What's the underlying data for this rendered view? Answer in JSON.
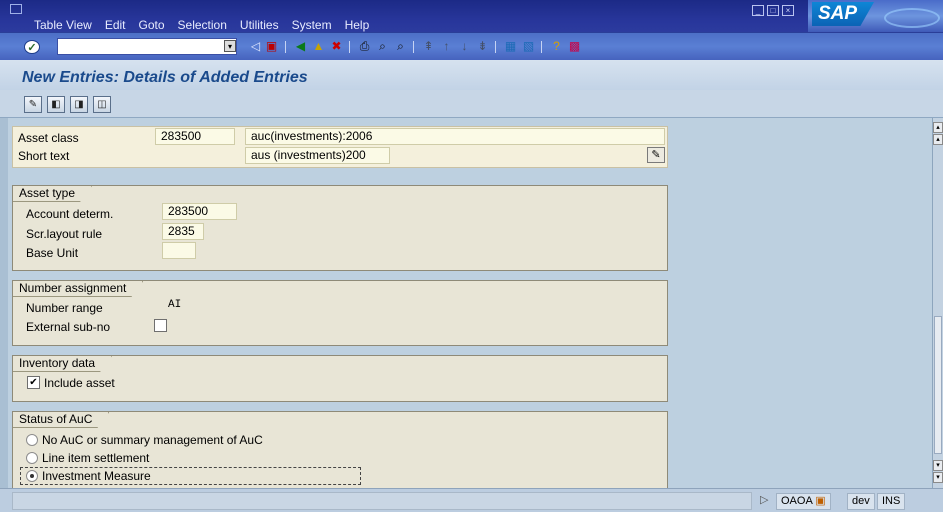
{
  "menu": {
    "items": [
      {
        "label": "Table View",
        "u": "T"
      },
      {
        "label": "Edit",
        "u": "E"
      },
      {
        "label": "Goto",
        "u": "G"
      },
      {
        "label": "Selection",
        "u": "S"
      },
      {
        "label": "Utilities",
        "u": ""
      },
      {
        "label": "System",
        "u": "y"
      },
      {
        "label": "Help",
        "u": "H"
      }
    ]
  },
  "brand": {
    "logo": "SAP"
  },
  "toolbar": {
    "command_value": "",
    "icons": [
      "back-icon",
      "save-icon",
      "back-green-icon",
      "exit-icon",
      "cancel-icon",
      "print-icon",
      "find-icon",
      "find-next-icon",
      "first-page-icon",
      "prev-page-icon",
      "next-page-icon",
      "last-page-icon",
      "new-session-icon",
      "shortcut-icon",
      "help-icon",
      "layout-icon"
    ]
  },
  "screen": {
    "title": "New Entries: Details of Added Entries"
  },
  "app_toolbar": {
    "buttons": [
      "display-change-icon",
      "prev-entry-icon",
      "next-entry-icon",
      "other-entry-icon"
    ]
  },
  "header": {
    "asset_class_label": "Asset class",
    "asset_class_value": "283500",
    "asset_class_desc": "auc(investments):2006",
    "short_text_label": "Short text",
    "short_text_value": "aus (investments)200"
  },
  "asset_type": {
    "title": "Asset type",
    "account_determ_label": "Account determ.",
    "account_determ_value": "283500",
    "scr_layout_label": "Scr.layout rule",
    "scr_layout_value": "2835",
    "base_unit_label": "Base Unit",
    "base_unit_value": ""
  },
  "number_assignment": {
    "title": "Number assignment",
    "number_range_label": "Number range",
    "number_range_value": "AI",
    "external_sub_label": "External sub-no",
    "external_sub_checked": false
  },
  "inventory": {
    "title": "Inventory data",
    "include_asset_label": "Include asset",
    "include_asset_checked": true
  },
  "status_auc": {
    "title": "Status of AuC",
    "options": [
      {
        "label": "No AuC or summary management of AuC",
        "selected": false
      },
      {
        "label": "Line item settlement",
        "selected": false
      },
      {
        "label": "Investment Measure",
        "selected": true
      }
    ]
  },
  "status_bar": {
    "transaction": "OAOA",
    "system": "dev",
    "mode": "INS"
  }
}
